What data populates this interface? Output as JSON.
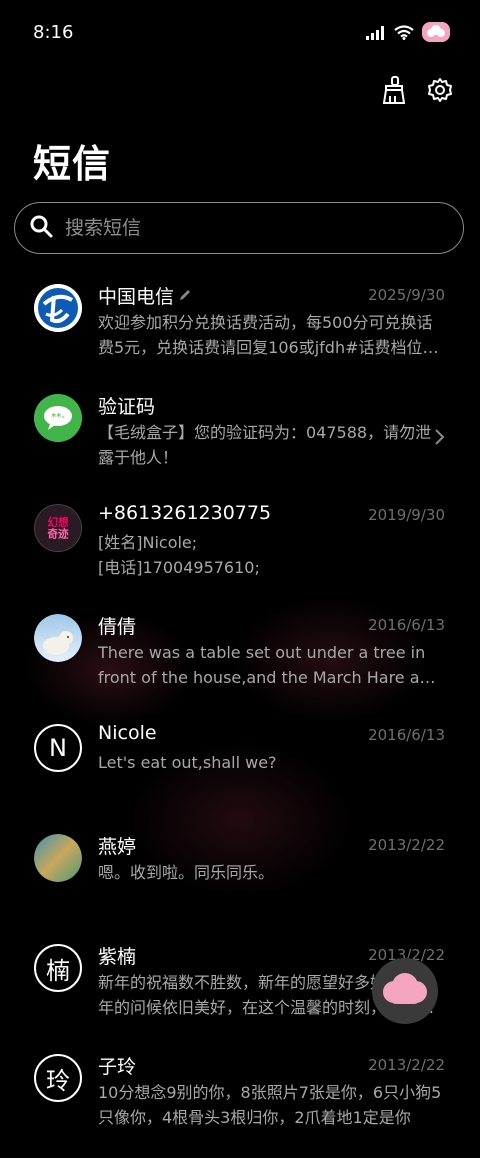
{
  "status_bar": {
    "time": "8:16",
    "icons": [
      "signal-icon",
      "wifi-icon",
      "cloud-badge-icon"
    ]
  },
  "header": {
    "title": "短信",
    "actions": [
      "broom-icon",
      "gear-icon"
    ]
  },
  "search": {
    "placeholder": "搜索短信"
  },
  "colors": {
    "background": "#000000",
    "secondary_text": "#a8a8a8",
    "date_text": "#6f6f6f",
    "accent_pink": "#f4a6c1"
  },
  "conversations": [
    {
      "name": "中国电信",
      "date": "2025/9/30",
      "preview": "欢迎参加积分兑换话费活动，每500分可兑换话费5元，兑换话费请回复106或jfdh#话费档位，如：106#5"
    },
    {
      "name": "验证码",
      "date": "",
      "preview": "【毛绒盒子】您的验证码为：047588，请勿泄露于他人！"
    },
    {
      "name": "+8613261230775",
      "date": "2019/9/30",
      "preview": "[姓名]Nicole;\n[电话]17004957610;"
    },
    {
      "name": "倩倩",
      "date": "2016/6/13",
      "preview": "There was a table set out under a tree in front of the house,and the March Hare and the Hatter were having tea"
    },
    {
      "name": "Nicole",
      "date": "2016/6/13",
      "preview": "Let's eat out,shall we?"
    },
    {
      "name": "燕婷",
      "date": "2013/2/22",
      "preview": "嗯。收到啦。同乐同乐。"
    },
    {
      "name": "紫楠",
      "date": "2013/2/22",
      "preview": "新年的祝福数不胜数，新年的愿望好多好多，新年的问候依旧美好，在这个温馨的时刻，送上祝福"
    },
    {
      "name": "子玲",
      "date": "2013/2/22",
      "preview": "10分想念9别的你，8张照片7张是你，6只小狗5只像你，4根骨头3根归你，2爪着地1定是你"
    }
  ],
  "avatars": {
    "nicole_letter": "N",
    "zinan_char": "楠",
    "ziling_char": "玲"
  }
}
